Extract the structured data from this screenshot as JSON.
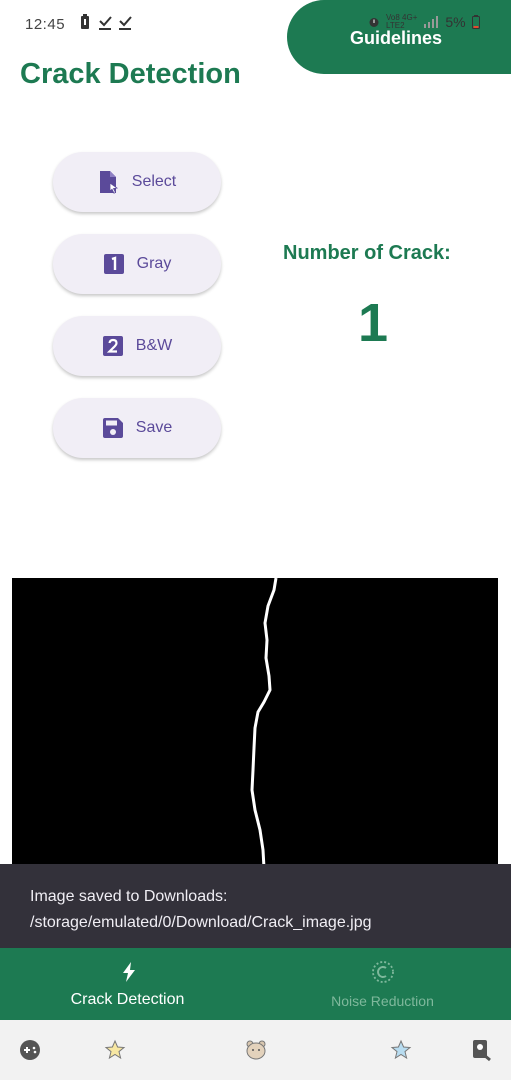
{
  "status_bar": {
    "time": "12:45",
    "network_text": "Vo8 4G+",
    "network_sub": "LTE2",
    "battery": "5%"
  },
  "header": {
    "title": "Crack Detection",
    "guidelines_label": "Guidelines"
  },
  "actions": [
    {
      "label": "Select",
      "icon": "file-select-icon"
    },
    {
      "label": "Gray",
      "icon": "number-one-icon"
    },
    {
      "label": "B&W",
      "icon": "number-two-icon"
    },
    {
      "label": "Save",
      "icon": "save-icon"
    }
  ],
  "result": {
    "label": "Number of Crack:",
    "value": "1"
  },
  "snackbar": {
    "message": "Image saved to Downloads: /storage/emulated/0/Download/Crack_image.jpg"
  },
  "bottom_nav": {
    "items": [
      {
        "label": "Crack Detection",
        "icon": "lightning-icon",
        "active": true
      },
      {
        "label": "Noise Reduction",
        "icon": "noise-reduction-icon",
        "active": false
      }
    ]
  },
  "colors": {
    "primary": "#1d7a52",
    "button_bg": "#f1eef6",
    "button_text": "#5b4a9a",
    "snackbar": "#33313a"
  }
}
